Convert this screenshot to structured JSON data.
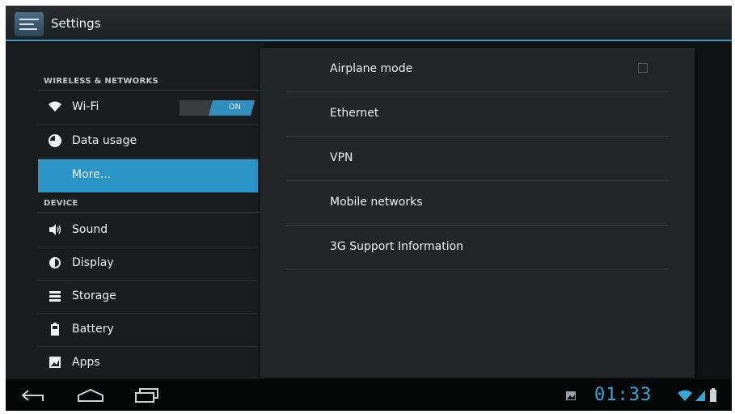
{
  "app": {
    "title": "Settings"
  },
  "left": {
    "sections": [
      "WIRELESS & NETWORKS",
      "DEVICE"
    ],
    "wifi": {
      "label": "Wi-Fi",
      "toggle": "ON"
    },
    "items": [
      "Data usage",
      "More...",
      "Sound",
      "Display",
      "Storage",
      "Battery",
      "Apps"
    ]
  },
  "right": {
    "items": [
      "Airplane mode",
      "Ethernet",
      "VPN",
      "Mobile networks",
      "3G Support Information"
    ]
  },
  "status": {
    "time": "01:33"
  },
  "colors": {
    "accent": "#2a95c6",
    "clock": "#36a7d6"
  }
}
